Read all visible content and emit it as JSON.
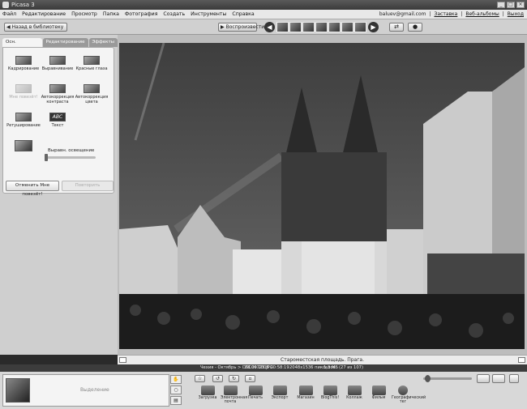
{
  "window": {
    "title": "Picasa 3"
  },
  "menu": [
    "Файл",
    "Редактирование",
    "Просмотр",
    "Папка",
    "Фотография",
    "Создать",
    "Инструменты",
    "Справка"
  ],
  "account": {
    "email": "baluev@gmail.com",
    "links": [
      "Заставка",
      "Веб-альбомы",
      "Выход"
    ]
  },
  "toolbar": {
    "back_label": "Назад в библиотеку",
    "play_label": "Воспроизвести"
  },
  "tabs": [
    "Осн. операции",
    "Редактирование",
    "Эффекты"
  ],
  "tools": [
    {
      "label": "Кадрирование",
      "enabled": true
    },
    {
      "label": "Выравнивание",
      "enabled": true
    },
    {
      "label": "Красные глаза",
      "enabled": true
    },
    {
      "label": "Мне повезёт!",
      "enabled": false
    },
    {
      "label": "Автокоррекция контраста",
      "enabled": true
    },
    {
      "label": "Автокоррекция цвета",
      "enabled": true
    },
    {
      "label": "Ретуширование",
      "enabled": true
    },
    {
      "label": "Текст",
      "enabled": true
    }
  ],
  "slider": {
    "label": "Выравн. освещение",
    "value": 0
  },
  "buttons": {
    "undo": "Отменить Мне повезёт!",
    "redo": "Повторить"
  },
  "photo": {
    "caption": "Староместская площадь. Прага."
  },
  "infobar": {
    "path": "Чехия - Октябрь > DSC06725.JPG",
    "date": "28.09.2008 20:58:19",
    "dims": "2048x1536 пикселов",
    "size": "1,3 МБ",
    "count": "(27 из 107)"
  },
  "tray": {
    "label": "Выделение"
  },
  "actions": [
    "Загрузка",
    "Электронная почта",
    "Печать",
    "Экспорт",
    "Магазин",
    "BlogThis!",
    "Коллаж",
    "Фильм",
    "Географический тег"
  ]
}
